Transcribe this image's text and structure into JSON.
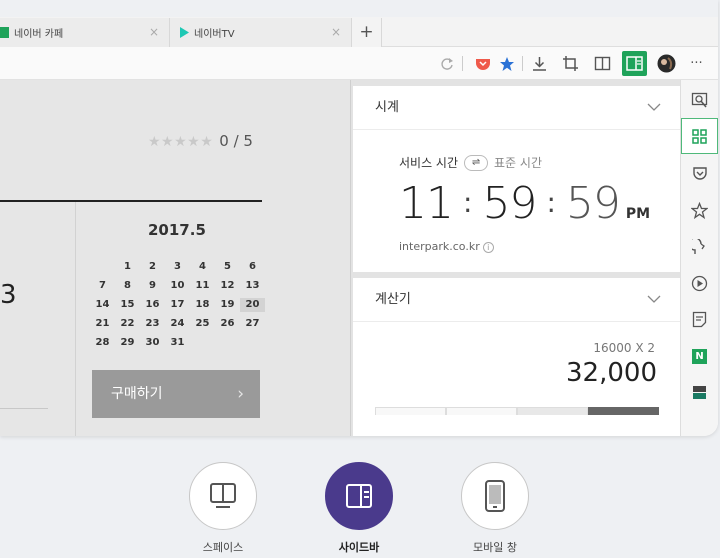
{
  "tabs": [
    {
      "label": "네이버 카페",
      "close": "×"
    },
    {
      "label": "네이버TV",
      "close": "×"
    }
  ],
  "new_tab": "+",
  "toolbar": {
    "more": "···"
  },
  "content": {
    "rating_stars": "★★★★★",
    "rating_score": "0 / 5",
    "calendar_month": "2017.5",
    "calendar_days": [
      "1",
      "2",
      "3",
      "4",
      "5",
      "6",
      "7",
      "8",
      "9",
      "10",
      "11",
      "12",
      "13",
      "14",
      "15",
      "16",
      "17",
      "18",
      "19",
      "20",
      "21",
      "22",
      "23",
      "24",
      "25",
      "26",
      "27",
      "28",
      "29",
      "30",
      "31"
    ],
    "calendar_today": "20",
    "partial_number": "3",
    "buy_button": "구매하기",
    "buy_arrow": "›"
  },
  "clock": {
    "title": "시계",
    "mode_active": "서비스 시간",
    "mode_swap": "⇌",
    "mode_alt": "표준 시간",
    "hours": "11",
    "minutes": "59",
    "seconds": "59",
    "colon": ":",
    "ampm": "PM",
    "source": "interpark.co.kr",
    "info": "i"
  },
  "calculator": {
    "title": "계산기",
    "expression": "16000 X 2",
    "result": "32,000"
  },
  "rail_active_label": "N",
  "modes": [
    {
      "label": "스페이스"
    },
    {
      "label": "사이드바"
    },
    {
      "label": "모바일 창"
    }
  ],
  "colors": {
    "accent_green": "#1fa35a",
    "mode_active": "#4a3a8c"
  }
}
